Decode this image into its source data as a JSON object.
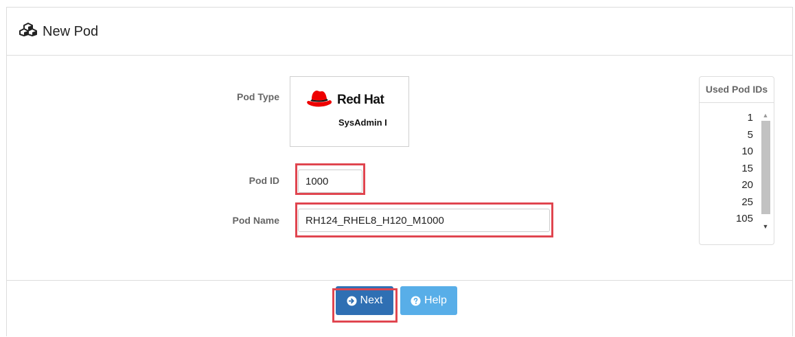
{
  "panel": {
    "title": "New Pod",
    "title_icon": "cubes-icon"
  },
  "form": {
    "pod_type_label": "Pod Type",
    "pod_type_brand": "Red Hat",
    "pod_type_course": "SysAdmin I",
    "pod_type_logo_icon": "redhat-fedora-icon",
    "pod_id_label": "Pod ID",
    "pod_id_value": "1000",
    "pod_name_label": "Pod Name",
    "pod_name_value": "RH124_RHEL8_H120_M1000"
  },
  "used_ids": {
    "header": "Used Pod IDs",
    "items": [
      "1",
      "5",
      "10",
      "15",
      "20",
      "25",
      "105"
    ]
  },
  "buttons": {
    "next_label": "Next",
    "next_icon": "arrow-circle-right-icon",
    "help_label": "Help",
    "help_icon": "question-circle-icon"
  },
  "colors": {
    "next_button": "#2f6fb3",
    "help_button": "#58aee8",
    "highlight": "#e0454f",
    "redhat_red": "#ee0000"
  }
}
